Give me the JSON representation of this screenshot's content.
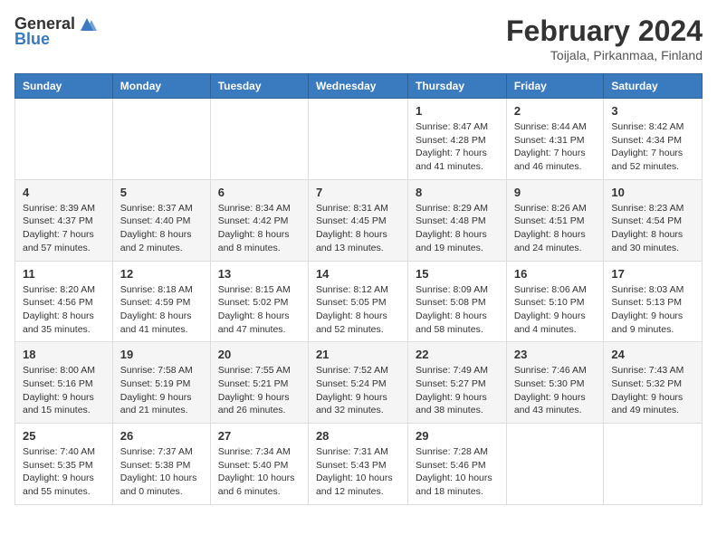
{
  "logo": {
    "general": "General",
    "blue": "Blue"
  },
  "title": "February 2024",
  "subtitle": "Toijala, Pirkanmaa, Finland",
  "days": [
    "Sunday",
    "Monday",
    "Tuesday",
    "Wednesday",
    "Thursday",
    "Friday",
    "Saturday"
  ],
  "weeks": [
    [
      {
        "day": "",
        "text": ""
      },
      {
        "day": "",
        "text": ""
      },
      {
        "day": "",
        "text": ""
      },
      {
        "day": "",
        "text": ""
      },
      {
        "day": "1",
        "text": "Sunrise: 8:47 AM\nSunset: 4:28 PM\nDaylight: 7 hours and 41 minutes."
      },
      {
        "day": "2",
        "text": "Sunrise: 8:44 AM\nSunset: 4:31 PM\nDaylight: 7 hours and 46 minutes."
      },
      {
        "day": "3",
        "text": "Sunrise: 8:42 AM\nSunset: 4:34 PM\nDaylight: 7 hours and 52 minutes."
      }
    ],
    [
      {
        "day": "4",
        "text": "Sunrise: 8:39 AM\nSunset: 4:37 PM\nDaylight: 7 hours and 57 minutes."
      },
      {
        "day": "5",
        "text": "Sunrise: 8:37 AM\nSunset: 4:40 PM\nDaylight: 8 hours and 2 minutes."
      },
      {
        "day": "6",
        "text": "Sunrise: 8:34 AM\nSunset: 4:42 PM\nDaylight: 8 hours and 8 minutes."
      },
      {
        "day": "7",
        "text": "Sunrise: 8:31 AM\nSunset: 4:45 PM\nDaylight: 8 hours and 13 minutes."
      },
      {
        "day": "8",
        "text": "Sunrise: 8:29 AM\nSunset: 4:48 PM\nDaylight: 8 hours and 19 minutes."
      },
      {
        "day": "9",
        "text": "Sunrise: 8:26 AM\nSunset: 4:51 PM\nDaylight: 8 hours and 24 minutes."
      },
      {
        "day": "10",
        "text": "Sunrise: 8:23 AM\nSunset: 4:54 PM\nDaylight: 8 hours and 30 minutes."
      }
    ],
    [
      {
        "day": "11",
        "text": "Sunrise: 8:20 AM\nSunset: 4:56 PM\nDaylight: 8 hours and 35 minutes."
      },
      {
        "day": "12",
        "text": "Sunrise: 8:18 AM\nSunset: 4:59 PM\nDaylight: 8 hours and 41 minutes."
      },
      {
        "day": "13",
        "text": "Sunrise: 8:15 AM\nSunset: 5:02 PM\nDaylight: 8 hours and 47 minutes."
      },
      {
        "day": "14",
        "text": "Sunrise: 8:12 AM\nSunset: 5:05 PM\nDaylight: 8 hours and 52 minutes."
      },
      {
        "day": "15",
        "text": "Sunrise: 8:09 AM\nSunset: 5:08 PM\nDaylight: 8 hours and 58 minutes."
      },
      {
        "day": "16",
        "text": "Sunrise: 8:06 AM\nSunset: 5:10 PM\nDaylight: 9 hours and 4 minutes."
      },
      {
        "day": "17",
        "text": "Sunrise: 8:03 AM\nSunset: 5:13 PM\nDaylight: 9 hours and 9 minutes."
      }
    ],
    [
      {
        "day": "18",
        "text": "Sunrise: 8:00 AM\nSunset: 5:16 PM\nDaylight: 9 hours and 15 minutes."
      },
      {
        "day": "19",
        "text": "Sunrise: 7:58 AM\nSunset: 5:19 PM\nDaylight: 9 hours and 21 minutes."
      },
      {
        "day": "20",
        "text": "Sunrise: 7:55 AM\nSunset: 5:21 PM\nDaylight: 9 hours and 26 minutes."
      },
      {
        "day": "21",
        "text": "Sunrise: 7:52 AM\nSunset: 5:24 PM\nDaylight: 9 hours and 32 minutes."
      },
      {
        "day": "22",
        "text": "Sunrise: 7:49 AM\nSunset: 5:27 PM\nDaylight: 9 hours and 38 minutes."
      },
      {
        "day": "23",
        "text": "Sunrise: 7:46 AM\nSunset: 5:30 PM\nDaylight: 9 hours and 43 minutes."
      },
      {
        "day": "24",
        "text": "Sunrise: 7:43 AM\nSunset: 5:32 PM\nDaylight: 9 hours and 49 minutes."
      }
    ],
    [
      {
        "day": "25",
        "text": "Sunrise: 7:40 AM\nSunset: 5:35 PM\nDaylight: 9 hours and 55 minutes."
      },
      {
        "day": "26",
        "text": "Sunrise: 7:37 AM\nSunset: 5:38 PM\nDaylight: 10 hours and 0 minutes."
      },
      {
        "day": "27",
        "text": "Sunrise: 7:34 AM\nSunset: 5:40 PM\nDaylight: 10 hours and 6 minutes."
      },
      {
        "day": "28",
        "text": "Sunrise: 7:31 AM\nSunset: 5:43 PM\nDaylight: 10 hours and 12 minutes."
      },
      {
        "day": "29",
        "text": "Sunrise: 7:28 AM\nSunset: 5:46 PM\nDaylight: 10 hours and 18 minutes."
      },
      {
        "day": "",
        "text": ""
      },
      {
        "day": "",
        "text": ""
      }
    ]
  ]
}
